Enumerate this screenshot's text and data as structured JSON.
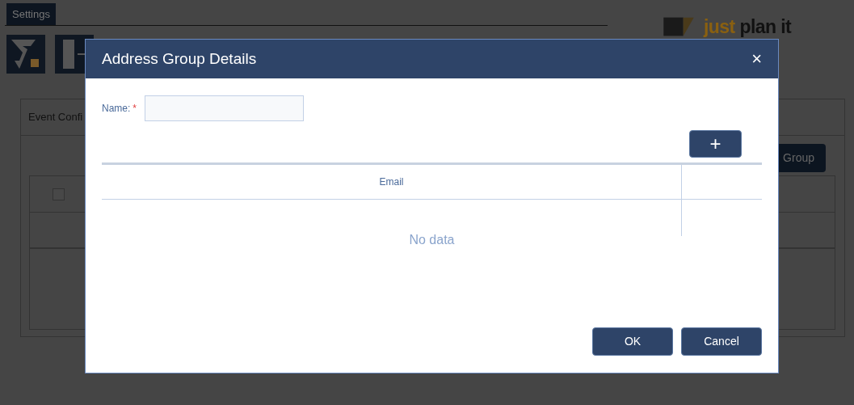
{
  "background": {
    "tab": {
      "label": "Settings",
      "selected": true
    },
    "logo": {
      "first": "just",
      "second": "plan it"
    },
    "panel_title": "Event Confi",
    "button": "Group",
    "select_all": {
      "checked": false
    }
  },
  "dialog": {
    "title": "Address Group Details",
    "close": "×",
    "name_field": {
      "label": "Name:",
      "required": true,
      "required_mark": "*"
    },
    "add_button": "+",
    "columns": [
      "Email"
    ],
    "empty_text": "No data",
    "buttons": [
      "OK",
      "Cancel"
    ]
  }
}
